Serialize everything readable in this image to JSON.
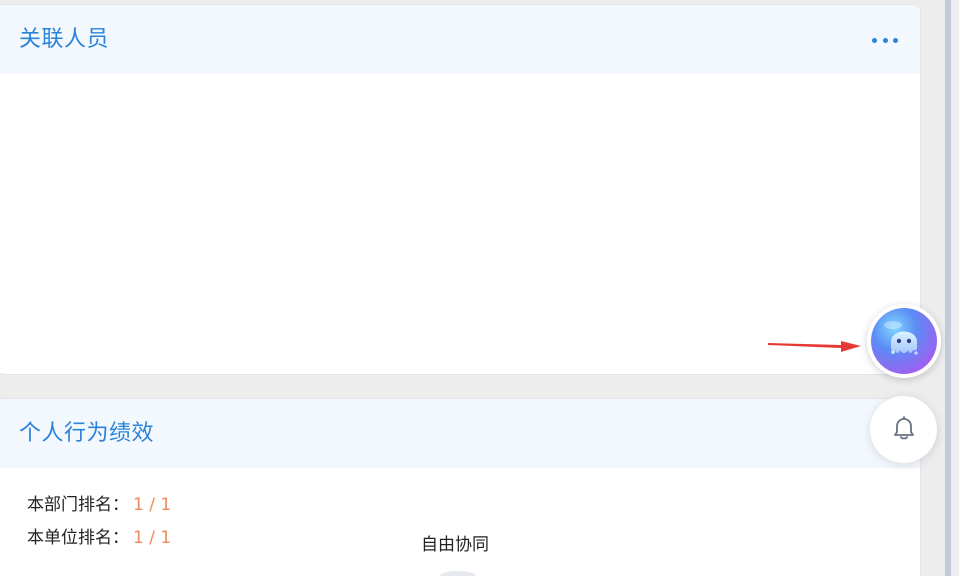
{
  "panels": {
    "related_people": {
      "title": "关联人员",
      "more_icon": "more-dots-icon"
    },
    "behavior_performance": {
      "title": "个人行为绩效",
      "more_icon": "more-dots-icon",
      "ranks": [
        {
          "label": "本部门排名：",
          "value": "1 / 1"
        },
        {
          "label": "本单位排名：",
          "value": "1 / 1"
        }
      ]
    }
  },
  "floating": {
    "collab_label": "自由协同",
    "assistant_icon": "octopus-assistant-icon",
    "notification_icon": "bell-icon"
  },
  "colors": {
    "accent": "#2a83d8",
    "rank_value": "#f08a5a",
    "header_bg": "#f3f8fe",
    "arrow": "#e53935"
  }
}
